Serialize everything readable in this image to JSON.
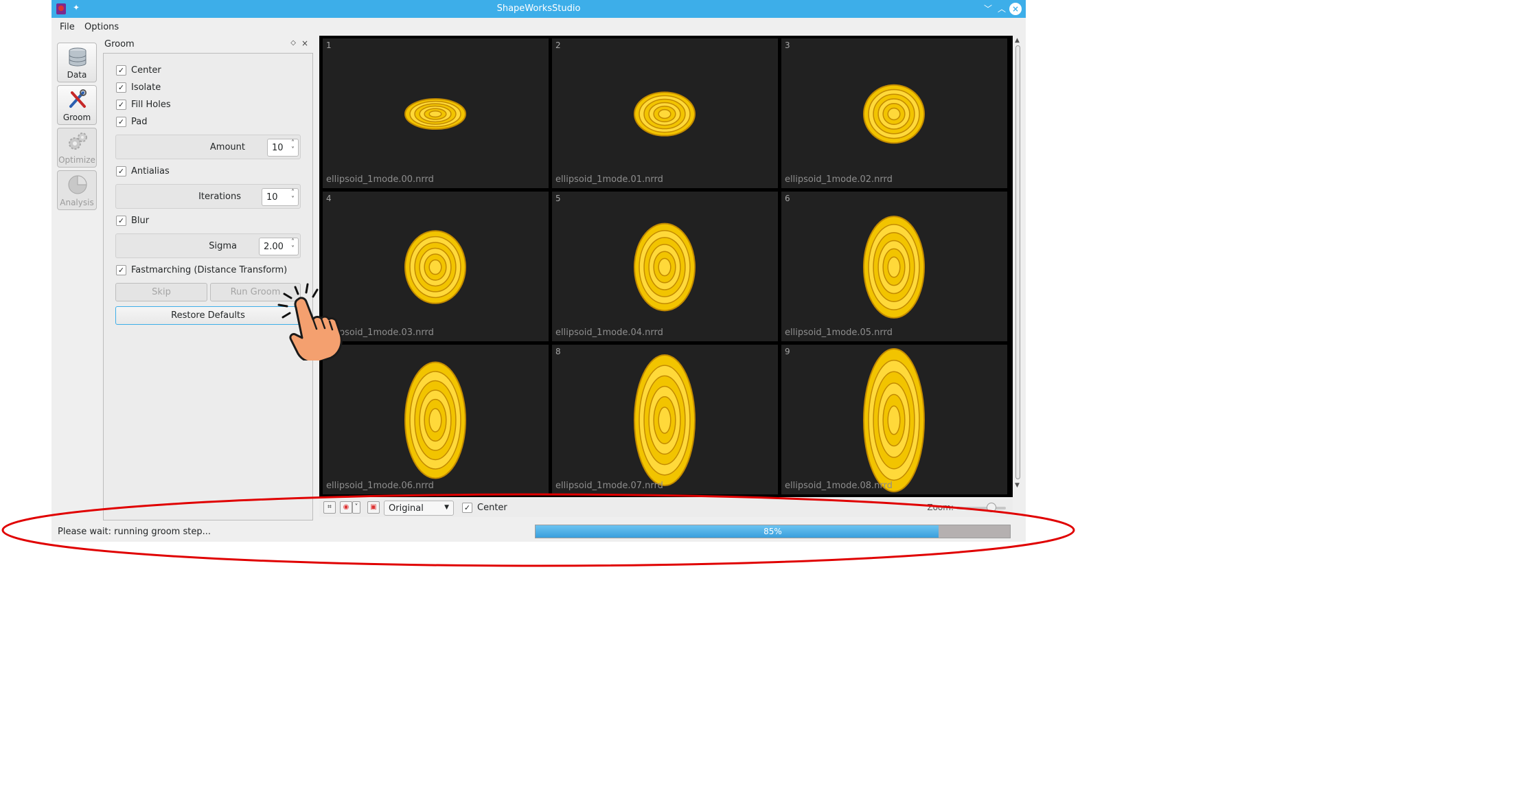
{
  "window": {
    "title": "ShapeWorksStudio"
  },
  "menubar": {
    "items": [
      "File",
      "Options"
    ]
  },
  "toolbox": {
    "items": [
      {
        "label": "Data",
        "icon": "database-icon"
      },
      {
        "label": "Groom",
        "icon": "groom-tools-icon"
      },
      {
        "label": "Optimize",
        "icon": "gears-icon"
      },
      {
        "label": "Analysis",
        "icon": "pie-chart-icon"
      }
    ]
  },
  "groom": {
    "title": "Groom",
    "center": "Center",
    "isolate": "Isolate",
    "fill_holes": "Fill Holes",
    "pad": "Pad",
    "amount_label": "Amount",
    "amount_value": "10",
    "antialias": "Antialias",
    "iterations_label": "Iterations",
    "iterations_value": "10",
    "blur": "Blur",
    "sigma_label": "Sigma",
    "sigma_value": "2.00",
    "fastmarching": "Fastmarching (Distance Transform)",
    "skip": "Skip",
    "run_groom": "Run Groom",
    "restore_defaults": "Restore Defaults"
  },
  "viewer": {
    "tiles": [
      {
        "index": "1",
        "file": "ellipsoid_1mode.00.nrrd",
        "scale_y": 0.5
      },
      {
        "index": "2",
        "file": "ellipsoid_1mode.01.nrrd",
        "scale_y": 0.72
      },
      {
        "index": "3",
        "file": "ellipsoid_1mode.02.nrrd",
        "scale_y": 0.96
      },
      {
        "index": "4",
        "file": "ellipsoid_1mode.03.nrrd",
        "scale_y": 1.2
      },
      {
        "index": "5",
        "file": "ellipsoid_1mode.04.nrrd",
        "scale_y": 1.44
      },
      {
        "index": "6",
        "file": "ellipsoid_1mode.05.nrrd",
        "scale_y": 1.68
      },
      {
        "index": "7",
        "file": "ellipsoid_1mode.06.nrrd",
        "scale_y": 1.92
      },
      {
        "index": "8",
        "file": "ellipsoid_1mode.07.nrrd",
        "scale_y": 2.16
      },
      {
        "index": "9",
        "file": "ellipsoid_1mode.08.nrrd",
        "scale_y": 2.4
      }
    ]
  },
  "viewbar": {
    "display_mode": "Original",
    "center_label": "Center",
    "zoom_label": "Zoom:"
  },
  "status": {
    "message": "Please wait: running groom step...",
    "progress_percent": 85,
    "progress_label": "85%"
  },
  "colors": {
    "titlebar": "#3daee9",
    "shape_fill": "#f2c400",
    "shape_ring": "#c28a00",
    "annotation": "#e00000"
  }
}
